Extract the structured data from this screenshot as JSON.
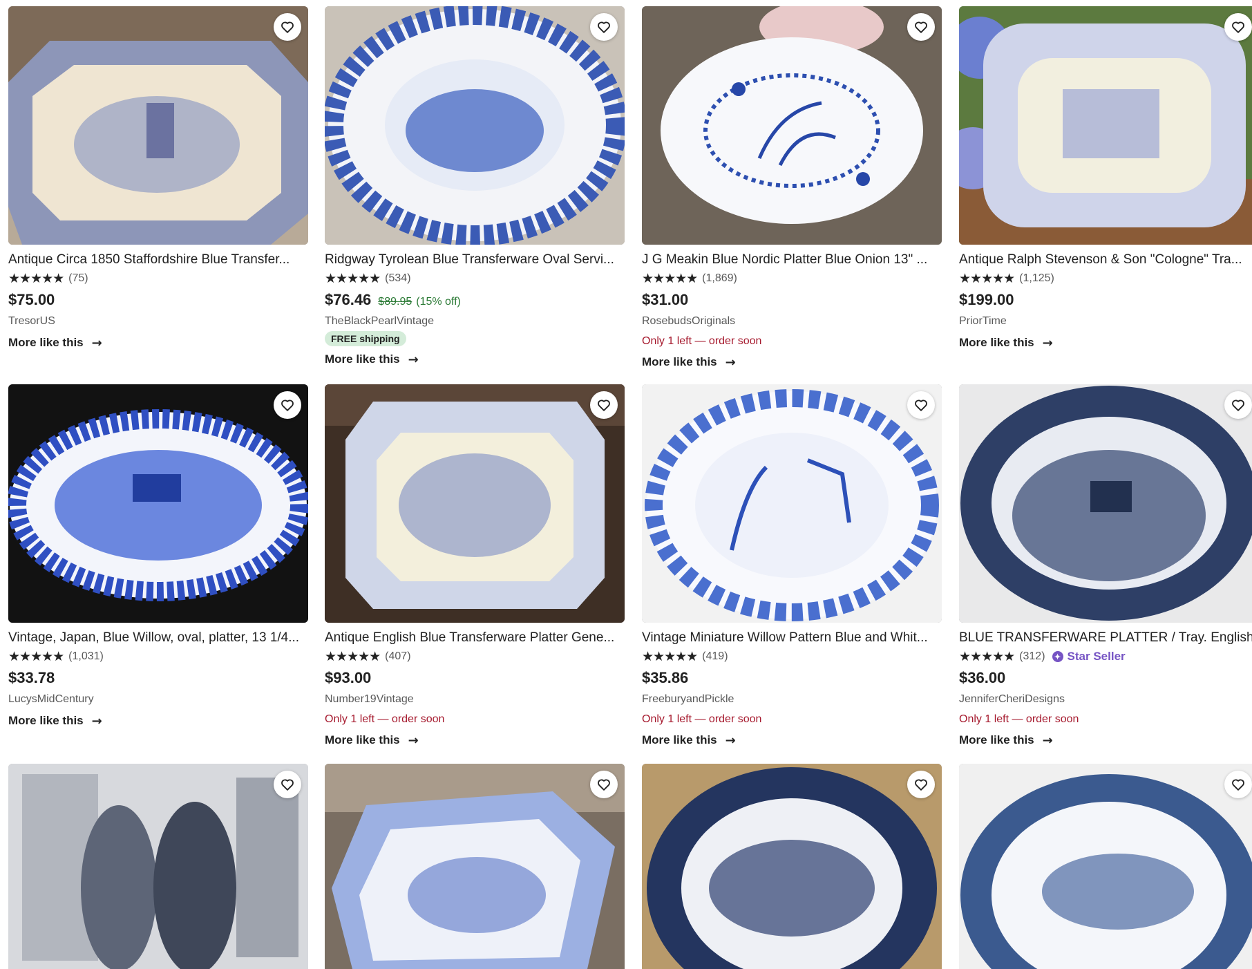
{
  "icons": {
    "favorite": "heart-outline-icon",
    "arrow": "arrow-right-icon",
    "star_seller": "star-seller-badge-icon"
  },
  "colors": {
    "sale_price": "#2b7a35",
    "low_stock": "#a61a2e",
    "star_seller": "#7654c4",
    "free_shipping_bg": "#d4ecd9"
  },
  "listings": [
    {
      "title": "Antique Circa 1850 Staffordshire Blue Transfer...",
      "stars": "★★★★★",
      "reviews": "(75)",
      "price": "$75.00",
      "shop": "TresorUS",
      "more": "More like this"
    },
    {
      "title": "Ridgway Tyrolean Blue Transferware Oval Servi...",
      "stars": "★★★★★",
      "reviews": "(534)",
      "price": "$76.46",
      "original_price": "$89.95",
      "discount": "(15% off)",
      "shop": "TheBlackPearlVintage",
      "shipping": "FREE shipping",
      "more": "More like this"
    },
    {
      "title": "J G Meakin Blue Nordic Platter Blue Onion 13\" ...",
      "stars": "★★★★★",
      "reviews": "(1,869)",
      "price": "$31.00",
      "shop": "RosebudsOriginals",
      "stock": "Only 1 left — order soon",
      "more": "More like this"
    },
    {
      "title": "Antique Ralph Stevenson & Son \"Cologne\" Tra...",
      "stars": "★★★★★",
      "reviews": "(1,125)",
      "price": "$199.00",
      "shop": "PriorTime",
      "more": "More like this"
    },
    {
      "title": "Vintage, Japan, Blue Willow, oval, platter, 13 1/4...",
      "stars": "★★★★★",
      "reviews": "(1,031)",
      "price": "$33.78",
      "shop": "LucysMidCentury",
      "more": "More like this"
    },
    {
      "title": "Antique English Blue Transferware Platter Gene...",
      "stars": "★★★★★",
      "reviews": "(407)",
      "price": "$93.00",
      "shop": "Number19Vintage",
      "stock": "Only 1 left — order soon",
      "more": "More like this"
    },
    {
      "title": "Vintage Miniature Willow Pattern Blue and Whit...",
      "stars": "★★★★★",
      "reviews": "(419)",
      "price": "$35.86",
      "shop": "FreeburyandPickle",
      "stock": "Only 1 left — order soon",
      "more": "More like this"
    },
    {
      "title": "BLUE TRANSFERWARE PLATTER / Tray. English ...",
      "stars": "★★★★★",
      "reviews": "(312)",
      "star_seller": "Star Seller",
      "price": "$36.00",
      "shop": "JenniferCheriDesigns",
      "stock": "Only 1 left — order soon",
      "more": "More like this"
    }
  ]
}
